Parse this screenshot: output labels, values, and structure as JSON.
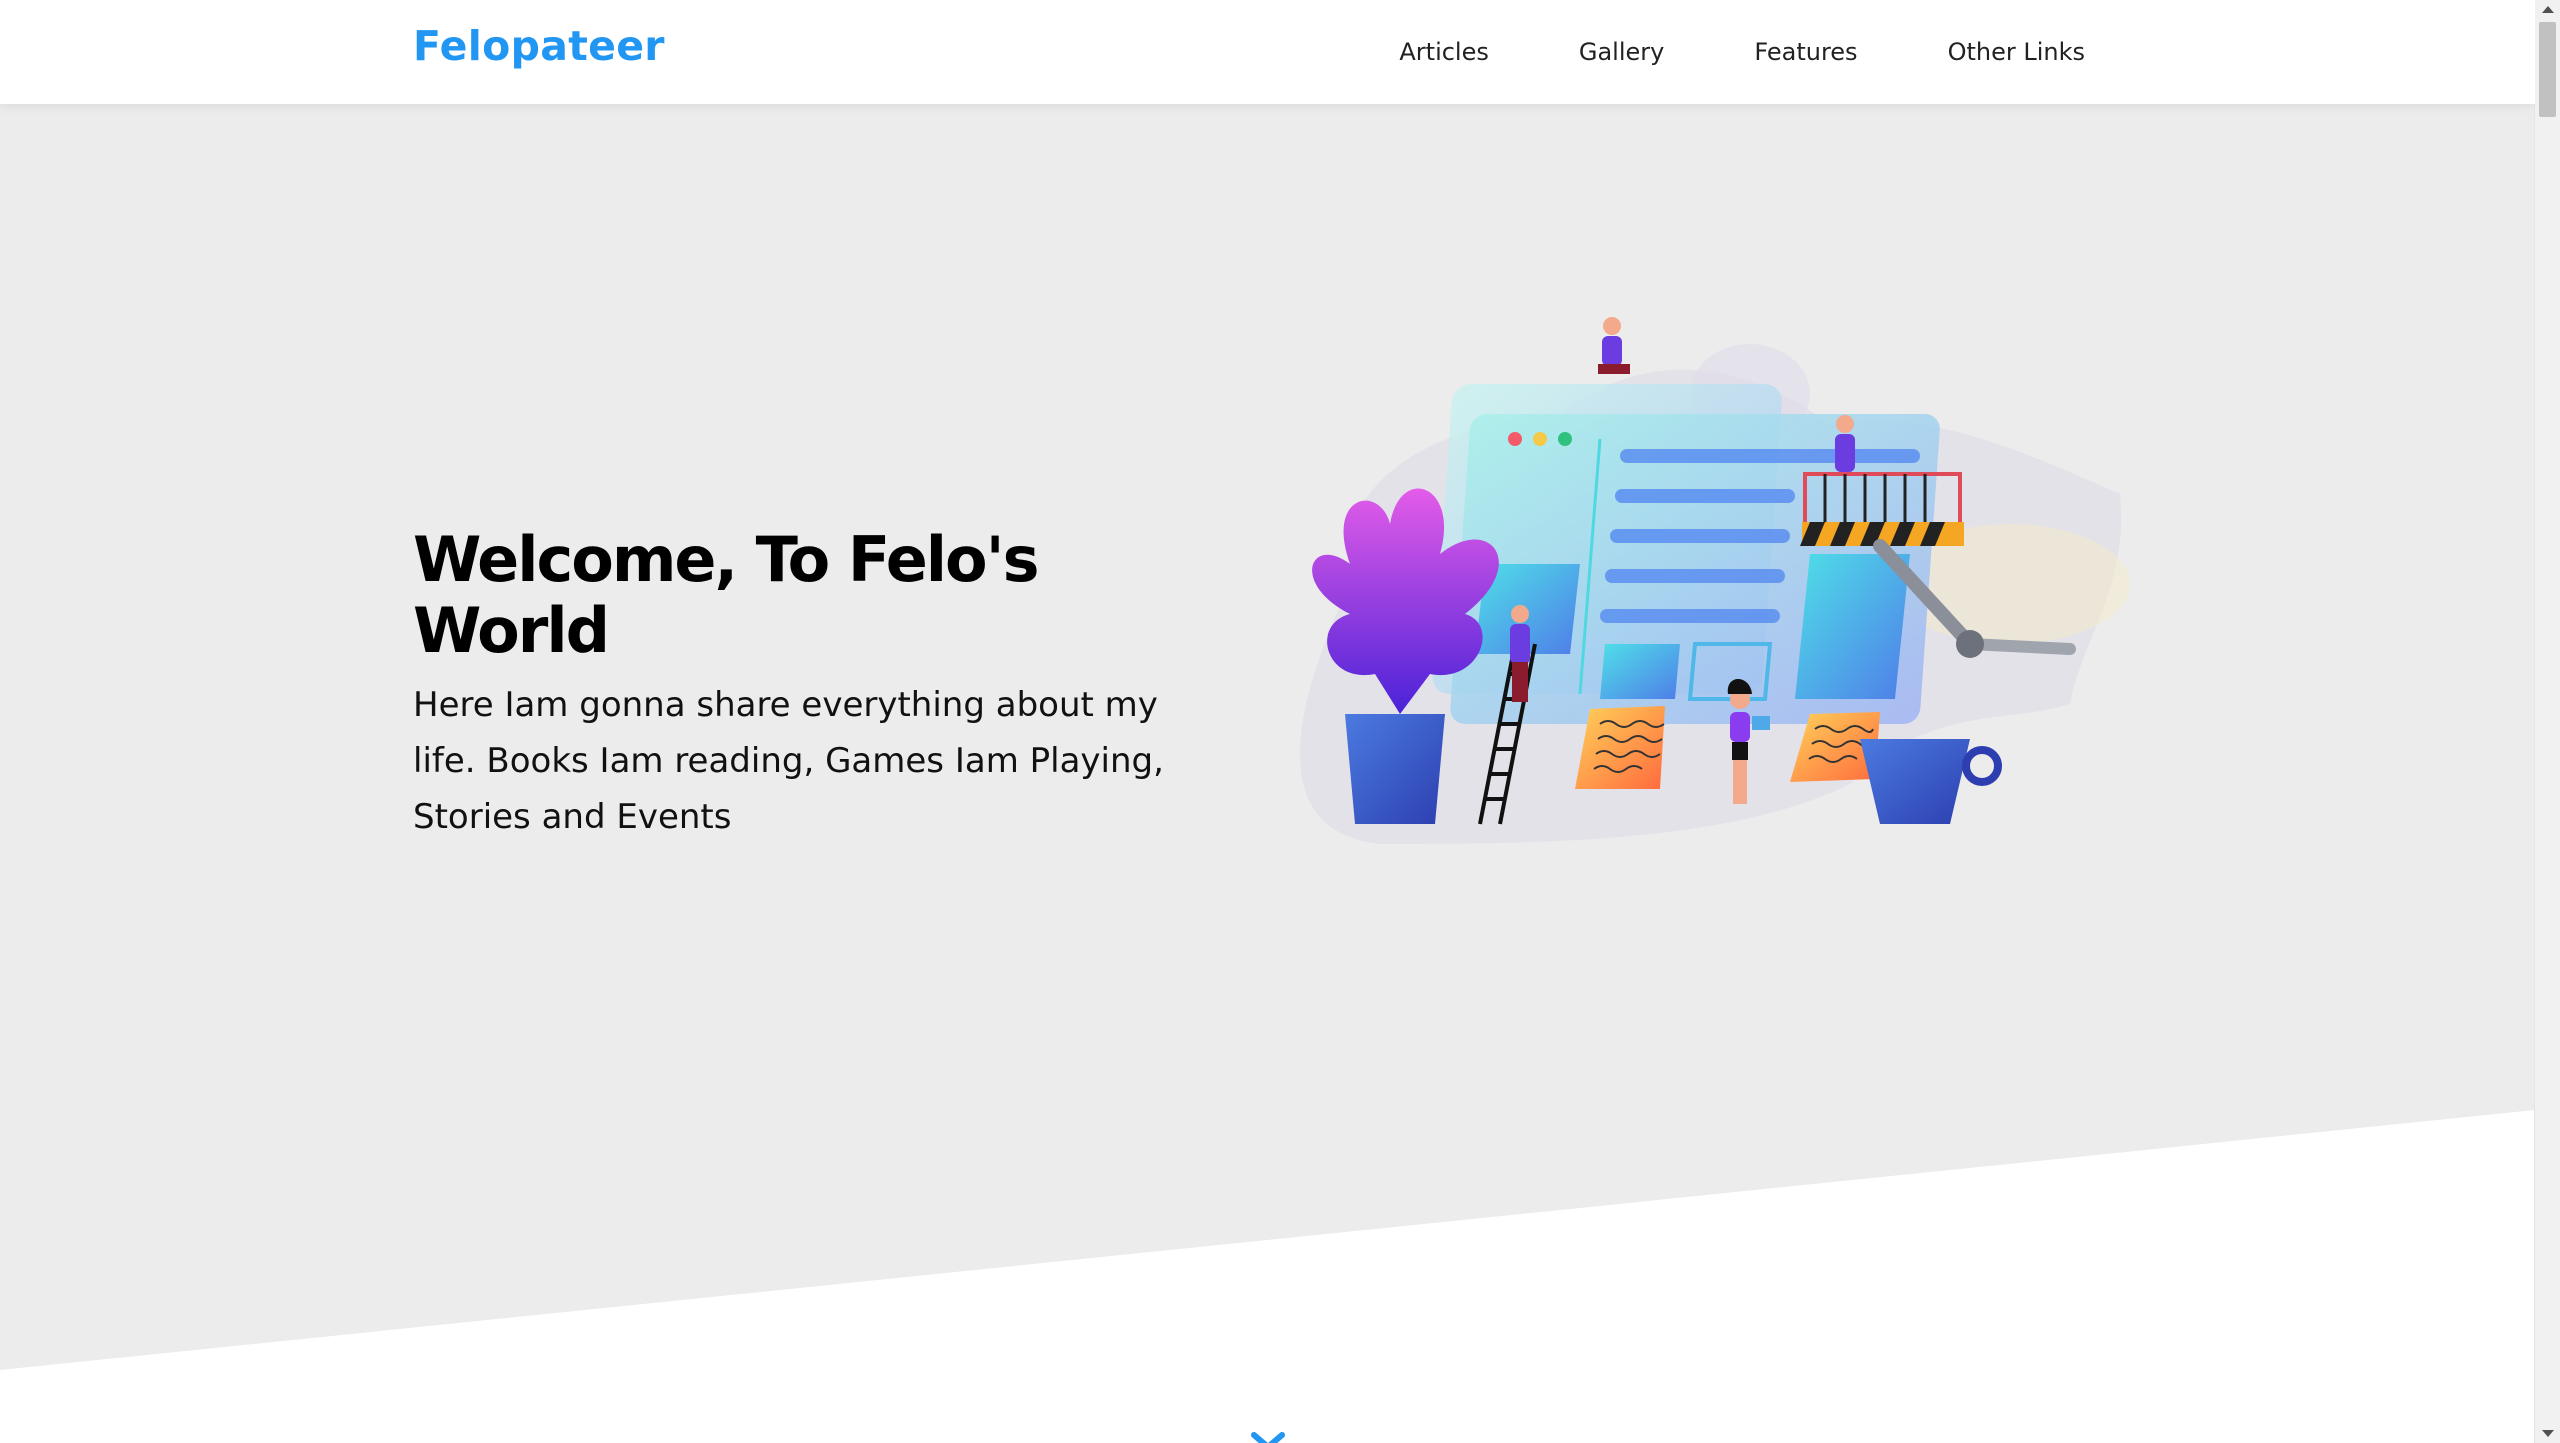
{
  "header": {
    "logo": "Felopateer",
    "nav": [
      {
        "label": "Articles"
      },
      {
        "label": "Gallery"
      },
      {
        "label": "Features"
      },
      {
        "label": "Other Links"
      }
    ]
  },
  "hero": {
    "title": "Welcome, To Felo's World",
    "description": "Here Iam gonna share everything about my life. Books Iam reading, Games Iam Playing, Stories and Events"
  },
  "colors": {
    "brand": "#2196f3",
    "hero_bg": "#ececec",
    "text": "#000000"
  },
  "icons": {
    "scroll_down": "double-chevron-down-icon",
    "illustration": "website-builders-illustration"
  }
}
